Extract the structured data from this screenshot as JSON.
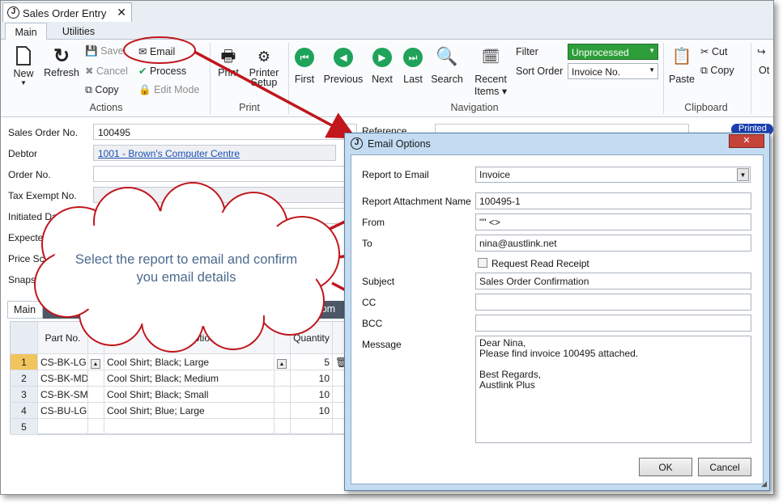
{
  "window": {
    "tab_title": "Sales Order Entry",
    "logo": "J",
    "close": "✕"
  },
  "ribbon": {
    "tabs": [
      "Main",
      "Utilities"
    ],
    "actions": {
      "new": "New",
      "refresh": "Refresh",
      "save": "Save",
      "cancel": "Cancel",
      "copy": "Copy",
      "email": "Email",
      "process": "Process",
      "edit_mode": "Edit Mode",
      "group": "Actions"
    },
    "print": {
      "print": "Print",
      "printer_setup_1": "Printer",
      "printer_setup_2": "Setup",
      "group": "Print"
    },
    "navigation": {
      "first": "First",
      "previous": "Previous",
      "next": "Next",
      "last": "Last",
      "search": "Search",
      "recent_1": "Recent",
      "recent_2": "Items ▾",
      "filter_label": "Filter",
      "filter_value": "Unprocessed",
      "sort_label": "Sort Order",
      "sort_value": "Invoice No.",
      "group": "Navigation"
    },
    "clipboard": {
      "paste": "Paste",
      "cut": "Cut",
      "copy": "Copy",
      "group": "Clipboard"
    },
    "other": "Ot"
  },
  "form": {
    "sales_order_label": "Sales Order No.",
    "sales_order_value": "100495",
    "debtor_label": "Debtor",
    "debtor_value": "1001 - Brown's Computer Centre",
    "order_no_label": "Order No.",
    "tax_exempt_label": "Tax Exempt No.",
    "initiated_label": "Initiated Date",
    "expected_label": "Expecte",
    "price_label": "Price Sch",
    "snaps_label": "Snaps",
    "reference_label": "Reference",
    "printed_badge": "Printed"
  },
  "lower_tabs": [
    "Main",
    "De",
    "stom"
  ],
  "grid": {
    "headers": {
      "part": "Part No.",
      "description": "scription",
      "quantity": "Quantity"
    },
    "rows": [
      {
        "n": "1",
        "part": "CS-BK-LG",
        "desc": "Cool Shirt; Black; Large",
        "qty": "5"
      },
      {
        "n": "2",
        "part": "CS-BK-MD",
        "desc": "Cool Shirt; Black; Medium",
        "qty": "10"
      },
      {
        "n": "3",
        "part": "CS-BK-SM",
        "desc": "Cool Shirt; Black; Small",
        "qty": "10"
      },
      {
        "n": "4",
        "part": "CS-BU-LG",
        "desc": "Cool Shirt; Blue; Large",
        "qty": "10"
      },
      {
        "n": "5",
        "part": "",
        "desc": "",
        "qty": ""
      }
    ]
  },
  "callout": {
    "text": "Select the report to email and confirm you email details"
  },
  "dialog": {
    "title": "Email Options",
    "report_label": "Report to Email",
    "report_value": "Invoice",
    "attachment_label": "Report Attachment Name",
    "attachment_value": "100495-1",
    "from_label": "From",
    "from_value": "\"\" <>",
    "to_label": "To",
    "to_value": "nina@austlink.net",
    "read_receipt": "Request Read Receipt",
    "subject_label": "Subject",
    "subject_value": "Sales Order Confirmation",
    "cc_label": "CC",
    "bcc_label": "BCC",
    "message_label": "Message",
    "message_lines": [
      "Dear Nina,",
      "Please find invoice 100495 attached.",
      "",
      "Best Regards,",
      "Austlink Plus"
    ],
    "ok": "OK",
    "cancel": "Cancel"
  },
  "colors": {
    "accent_green": "#1fa35a",
    "arrow_red": "#c0161c",
    "dialog_frame": "#c3dcf2",
    "filter_green": "#2e9e3a"
  }
}
